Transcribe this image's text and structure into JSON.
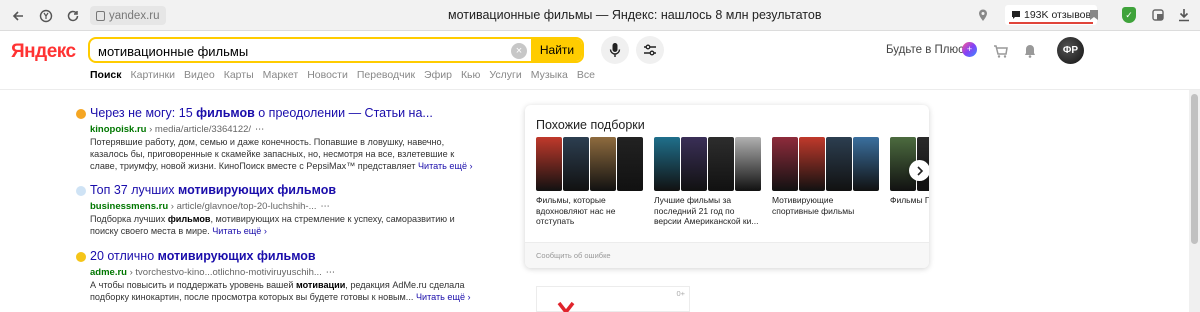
{
  "browser": {
    "domain": "yandex.ru",
    "tab_title": "мотивационные фильмы — Яндекс: нашлось 8 млн результатов",
    "reviews_badge": "193K отзывов"
  },
  "header": {
    "logo": "Яндекс",
    "search_value": "мотивационные фильмы",
    "find_label": "Найти",
    "plus_link": "Будьте в Плюсе"
  },
  "services": [
    "Поиск",
    "Картинки",
    "Видео",
    "Карты",
    "Маркет",
    "Новости",
    "Переводчик",
    "Эфир",
    "Кью",
    "Услуги",
    "Музыка",
    "Все"
  ],
  "results": [
    {
      "title_pre": "Через не могу: 15 ",
      "title_bold": "фильмов",
      "title_post": " о преодолении — Статьи на...",
      "host": "kinopoisk.ru",
      "path": " › media/article/3364122/",
      "snippet_pre": "Потерявшие работу, дом, семью и даже конечность. Попавшие в ловушку, навечно, казалось бы, приговоренные к скамейке запасных, но, несмотря на все, взлетевшие к славе, триумфу, новой жизни. КиноПоиск вместе с PepsiMax™ представляет",
      "snippet_bold": "",
      "snippet_post": "",
      "more": "Читать ещё ›",
      "favicon_color": "#f5a623"
    },
    {
      "title_pre": "Топ 37 лучших ",
      "title_bold": "мотивирующих фильмов",
      "title_post": "",
      "host": "businessmens.ru",
      "path": " › article/glavnoe/top-20-luchshih-...",
      "snippet_pre": "Подборка лучших ",
      "snippet_bold": "фильмов",
      "snippet_post": ", мотивирующих на стремление к успеху, саморазвитию и поиску своего места в мире.",
      "more": "Читать ещё ›",
      "favicon_color": "#cfe3f5"
    },
    {
      "title_pre": "20 отлично ",
      "title_bold": "мотивирующих фильмов",
      "title_post": "",
      "host": "adme.ru",
      "path": " › tvorchestvo-kino...otlichno-motiviruyuschih...",
      "snippet_pre": "А чтобы повысить и поддержать уровень вашей ",
      "snippet_bold": "мотивации",
      "snippet_post": ", редакция AdMe.ru сделала подборку кинокартин, после просмотра которых вы будете готовы к новым...",
      "more": "Читать ещё ›",
      "favicon_color": "#f5c518"
    }
  ],
  "collections": {
    "title": "Похожие подборки",
    "items": [
      {
        "label": "Фильмы, которые вдохновляют нас не отступать",
        "colors": [
          "#c0392b",
          "#2c3e50",
          "#8e6b3e",
          "#222222"
        ]
      },
      {
        "label": "Лучшие фильмы за последний 21 год по версии Американской ки...",
        "colors": [
          "#1f6f8b",
          "#3a2f57",
          "#2d2d2d",
          "#b0b0b0"
        ]
      },
      {
        "label": "Мотивирующие спортивные фильмы",
        "colors": [
          "#8e2b3b",
          "#c0392b",
          "#2c3e50",
          "#3a6f9e"
        ]
      },
      {
        "label": "Фильмы Питтом",
        "colors": [
          "#4c6b3f",
          "#2a2a2a",
          "#888888",
          "#555555"
        ]
      }
    ],
    "footer": "Сообщить об ошибке"
  },
  "ad": {
    "mark": "0+"
  },
  "colors": {
    "accent": "#ffcc00",
    "link": "#1a0dab",
    "url": "#007700"
  }
}
